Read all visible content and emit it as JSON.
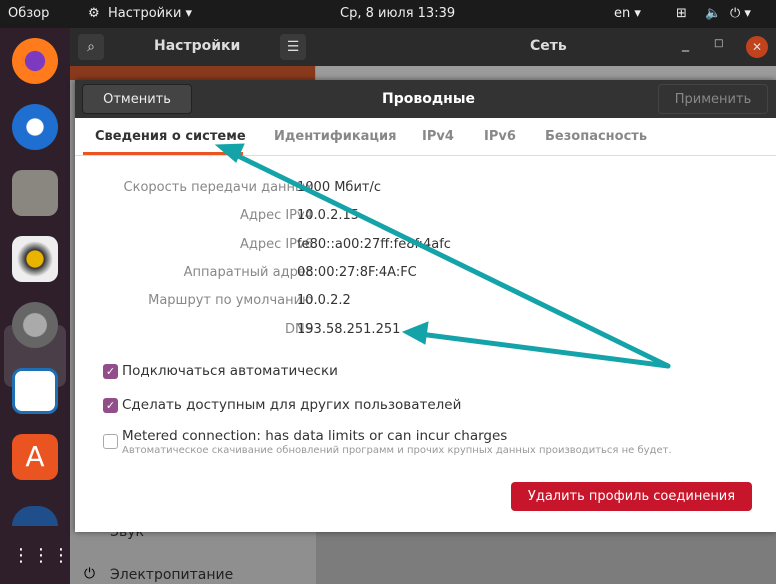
{
  "topbar": {
    "activities": "Обзор",
    "app_menu": "Настройки ▾",
    "clock": "Ср, 8 июля  13:39",
    "lang": "en ▾"
  },
  "window": {
    "sidebar_title": "Настройки",
    "title": "Сеть",
    "sidebar_items": [
      "Звук",
      "Электропитание"
    ]
  },
  "dialog": {
    "title": "Проводные",
    "cancel": "Отменить",
    "apply": "Применить",
    "tabs": [
      "Сведения о системе",
      "Идентификация",
      "IPv4",
      "IPv6",
      "Безопасность"
    ],
    "details": [
      {
        "label": "Скорость передачи данных",
        "value": "1000 Мбит/с"
      },
      {
        "label": "Адрес IPv4",
        "value": "10.0.2.15"
      },
      {
        "label": "Адрес IPv6",
        "value": "fe80::a00:27ff:fe8f:4afc"
      },
      {
        "label": "Аппаратный адрес",
        "value": "08:00:27:8F:4A:FC"
      },
      {
        "label": "Маршрут по умолчанию",
        "value": "10.0.2.2"
      },
      {
        "label": "DNS",
        "value": "193.58.251.251"
      }
    ],
    "auto_connect": {
      "label": "Подключаться автоматически",
      "checked": true
    },
    "share": {
      "label": "Сделать доступным для других пользователей",
      "checked": true
    },
    "metered": {
      "label": "Metered connection: has data limits or can incur charges",
      "hint": "Автоматическое скачивание обновлений программ и прочих крупных данных производиться не будет.",
      "checked": false
    },
    "delete": "Удалить профиль соединения"
  },
  "colors": {
    "accent": "#e95420",
    "check": "#924d8b",
    "danger": "#c7162b",
    "arrow": "#14a3a8"
  }
}
